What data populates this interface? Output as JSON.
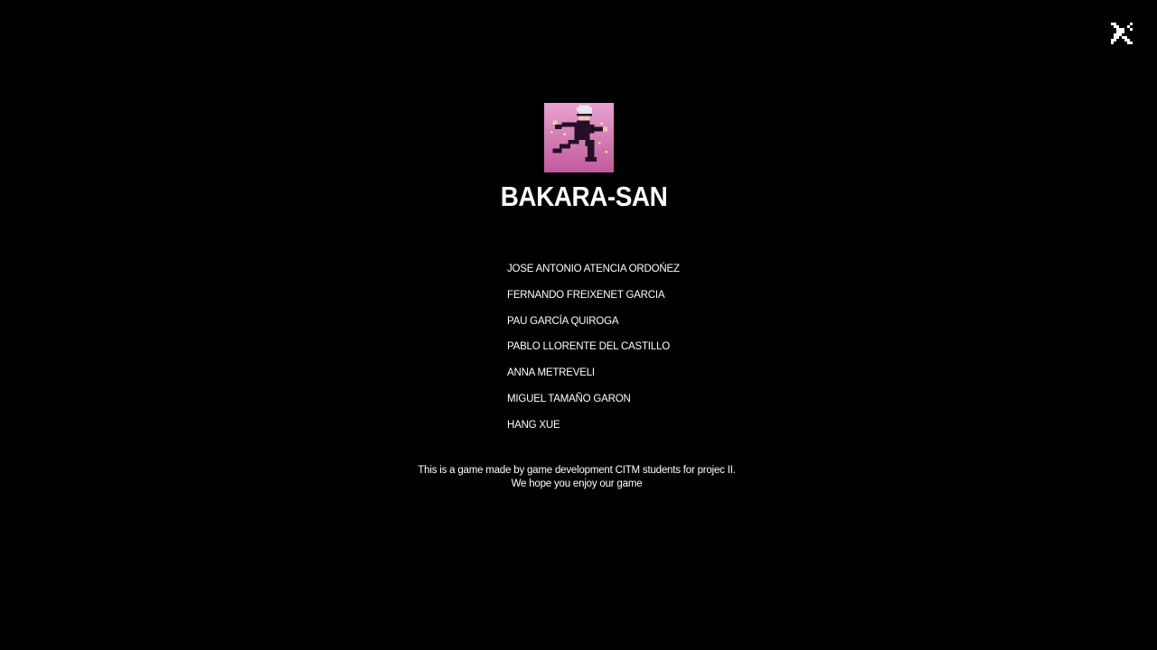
{
  "close_button": {
    "icon": "close-icon"
  },
  "logo": {
    "icon": "team-logo-pixel-character"
  },
  "team": {
    "name": "BAKARA-SAN",
    "members": [
      "JOSE ANTONIO ATENCIA ORDOŃEZ",
      "FERNANDO FREIXENET GARCIA",
      "PAU GARCÍA QUIROGA",
      "PABLO LLORENTE DEL CASTILLO",
      "ANNA METREVELI",
      "MIGUEL TAMAÑO GARON",
      "HANG XUE"
    ]
  },
  "footer": {
    "line1": "This is a game made by game development CITM students for projec II.",
    "line2": "We hope you enjoy our game"
  },
  "colors": {
    "background": "#000000",
    "text": "#ffffff",
    "logo_background": "#c86aa8"
  }
}
